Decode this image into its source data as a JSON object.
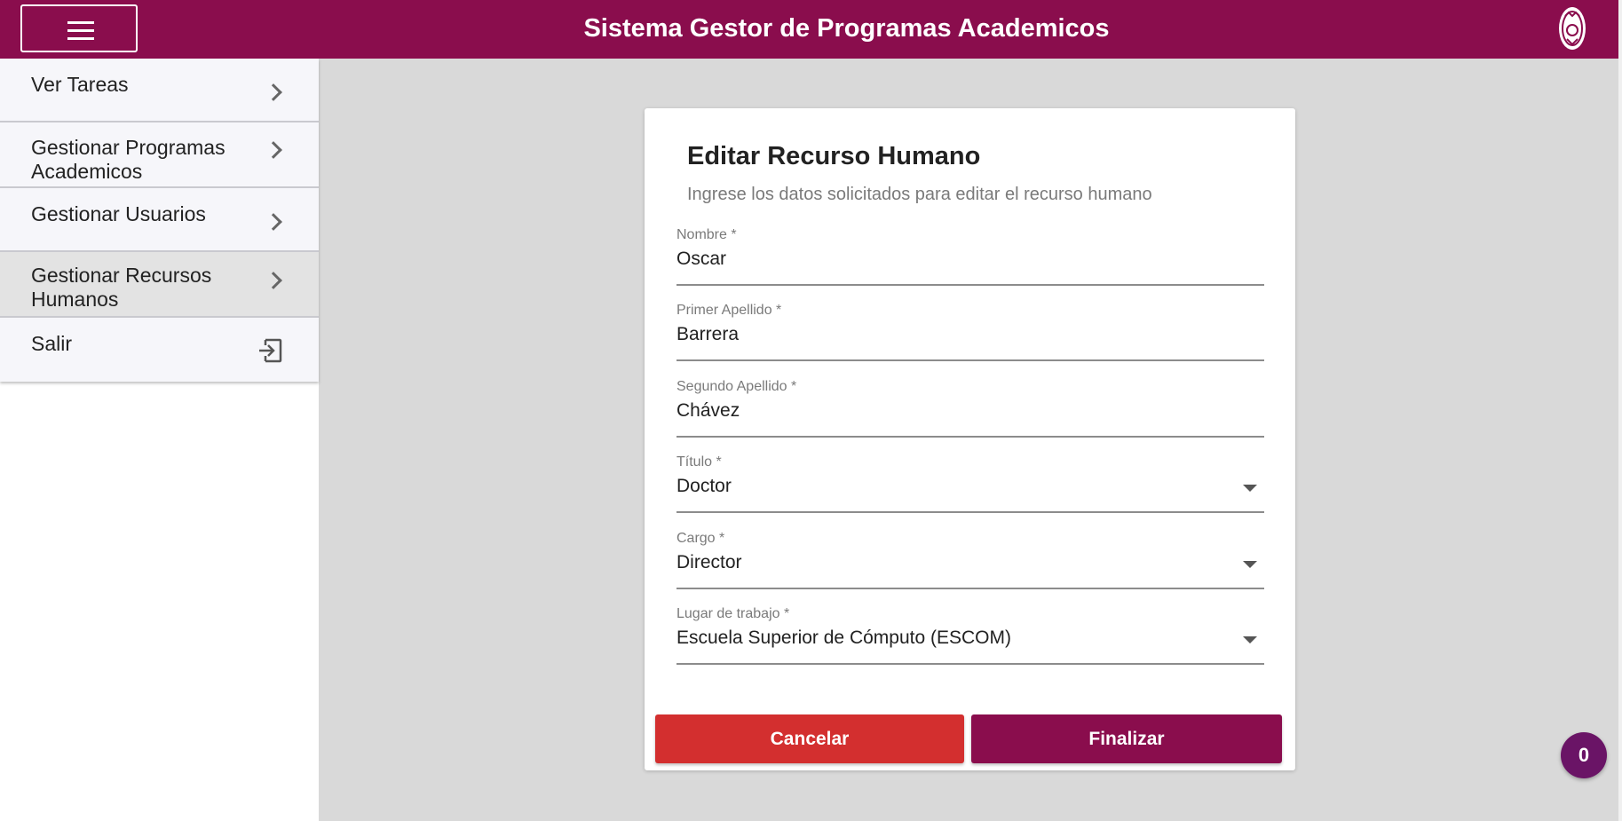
{
  "header": {
    "title": "Sistema Gestor de Programas Academicos",
    "menu_icon": "hamburger-menu-icon",
    "logo_icon": "institution-logo-icon",
    "brand_color": "#8a0d4d"
  },
  "sidebar": {
    "items": [
      {
        "label": "Ver Tareas",
        "icon": "chevron-right-icon"
      },
      {
        "label": "Gestionar Programas Academicos",
        "icon": "chevron-right-icon"
      },
      {
        "label": "Gestionar Usuarios",
        "icon": "chevron-right-icon"
      },
      {
        "label": "Gestionar Recursos Humanos",
        "icon": "chevron-right-icon",
        "active": true
      },
      {
        "label": "Salir",
        "icon": "exit-icon"
      }
    ]
  },
  "form": {
    "title": "Editar Recurso Humano",
    "subtitle": "Ingrese los datos solicitados para editar el recurso humano",
    "fields": [
      {
        "label": "Nombre *",
        "value": "Oscar",
        "type": "text"
      },
      {
        "label": "Primer Apellido *",
        "value": "Barrera",
        "type": "text"
      },
      {
        "label": "Segundo Apellido *",
        "value": "Chávez",
        "type": "text"
      },
      {
        "label": "Título *",
        "value": "Doctor",
        "type": "select"
      },
      {
        "label": "Cargo *",
        "value": "Director",
        "type": "select"
      },
      {
        "label": "Lugar de trabajo *",
        "value": "Escuela Superior de Cómputo (ESCOM)",
        "type": "select"
      }
    ],
    "cancel_label": "Cancelar",
    "finish_label": "Finalizar",
    "cancel_color": "#d32f2f",
    "finish_color": "#8a0d4d"
  },
  "fab": {
    "count": "0"
  }
}
